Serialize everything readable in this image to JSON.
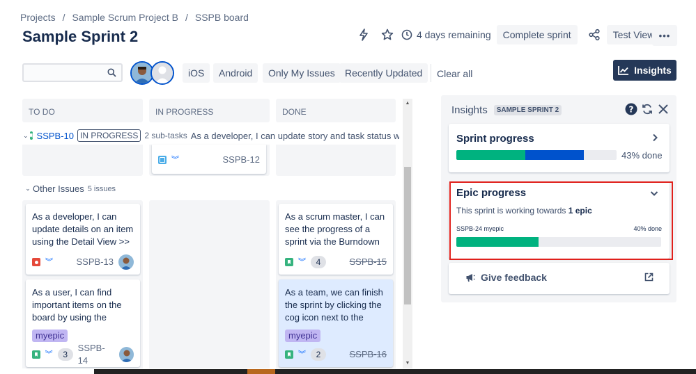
{
  "breadcrumb": [
    "Projects",
    "Sample Scrum Project B",
    "SSPB board"
  ],
  "sprint": {
    "title": "Sample Sprint 2",
    "remaining": "4 days remaining",
    "complete_label": "Complete sprint",
    "view_label": "Test View",
    "more_label": "•••"
  },
  "filters": {
    "search_value": "",
    "quick_filters": [
      "iOS",
      "Android",
      "Only My Issues",
      "Recently Updated"
    ],
    "clear_all": "Clear all",
    "insights_label": "Insights"
  },
  "columns": [
    "TO DO",
    "IN PROGRESS",
    "DONE"
  ],
  "swimlane": {
    "key": "SSPB-10",
    "status": "IN PROGRESS",
    "subtasks": "2 sub-tasks",
    "summary": "As a developer, I can update story and task status wit"
  },
  "subtask_card": {
    "key": "SSPB-12"
  },
  "other_issues": {
    "label": "Other Issues",
    "count": "5 issues"
  },
  "cards": {
    "todo_1": {
      "text": "As a developer, I can update details on an item using the Detail View >>",
      "key": "SSPB-13"
    },
    "todo_2": {
      "text": "As a user, I can find important items on the board by using the",
      "epic": "myepic",
      "count": "3",
      "key": "SSPB-14"
    },
    "done_1": {
      "text": "As a scrum master, I can see the progress of a sprint via the Burndown",
      "count": "4",
      "key": "SSPB-15"
    },
    "done_2": {
      "text": "As a team, we can finish the sprint by clicking the cog icon next to the",
      "epic": "myepic",
      "count": "2",
      "key": "SSPB-16"
    }
  },
  "insights": {
    "title": "Insights",
    "sprint_tag": "SAMPLE SPRINT 2",
    "sprint_progress": {
      "title": "Sprint progress",
      "done_text": "43% done",
      "done_fraction": 0.43,
      "in_progress_fraction": 0.365,
      "colors": {
        "done": "#00b27f",
        "in_progress": "#0052cc"
      }
    },
    "epic_progress": {
      "title": "Epic progress",
      "summary_prefix": "This sprint is working towards ",
      "summary_bold": "1 epic",
      "epic_name": "SSPB-24 myepic",
      "epic_done_text": "40% done",
      "epic_fraction": 0.4
    },
    "feedback_label": "Give feedback"
  }
}
